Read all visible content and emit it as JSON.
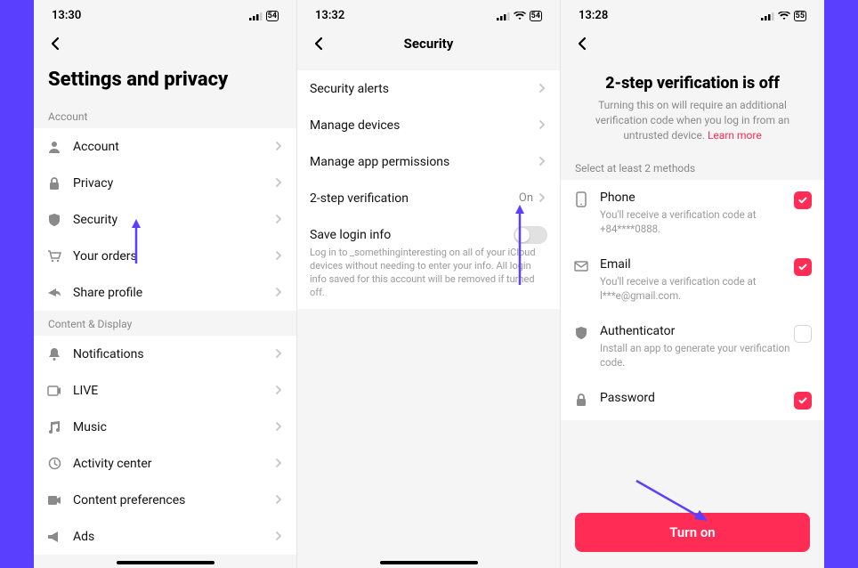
{
  "screen1": {
    "time": "13:30",
    "battery": "54",
    "title": "Settings and privacy",
    "section_account": "Account",
    "account_items": [
      {
        "label": "Account"
      },
      {
        "label": "Privacy"
      },
      {
        "label": "Security"
      },
      {
        "label": "Your orders"
      },
      {
        "label": "Share profile"
      }
    ],
    "section_content": "Content & Display",
    "content_items": [
      {
        "label": "Notifications"
      },
      {
        "label": "LIVE"
      },
      {
        "label": "Music"
      },
      {
        "label": "Activity center"
      },
      {
        "label": "Content preferences"
      },
      {
        "label": "Ads"
      }
    ]
  },
  "screen2": {
    "time": "13:32",
    "battery": "54",
    "title": "Security",
    "items": [
      {
        "label": "Security alerts"
      },
      {
        "label": "Manage devices"
      },
      {
        "label": "Manage app permissions"
      },
      {
        "label": "2-step verification",
        "value": "On"
      }
    ],
    "save_login": {
      "label": "Save login info",
      "desc": "Log in to _somethinginteresting on all of your iCloud devices without needing to enter your info. All login info saved for this account will be removed if turned off."
    }
  },
  "screen3": {
    "time": "13:28",
    "battery": "55",
    "hero_title": "2-step verification is off",
    "hero_desc": "Turning this on will require an additional verification code when you log in from an untrusted device.",
    "learn_more": "Learn more",
    "select_label": "Select at least 2 methods",
    "methods": [
      {
        "name": "Phone",
        "sub": "You'll receive a verification code at +84****0888.",
        "checked": true
      },
      {
        "name": "Email",
        "sub": "You'll receive a verification code at l***e@gmail.com.",
        "checked": true
      },
      {
        "name": "Authenticator",
        "sub": "Install an app to generate your verification code.",
        "checked": false
      },
      {
        "name": "Password",
        "sub": "",
        "checked": true
      }
    ],
    "turn_on": "Turn on"
  }
}
